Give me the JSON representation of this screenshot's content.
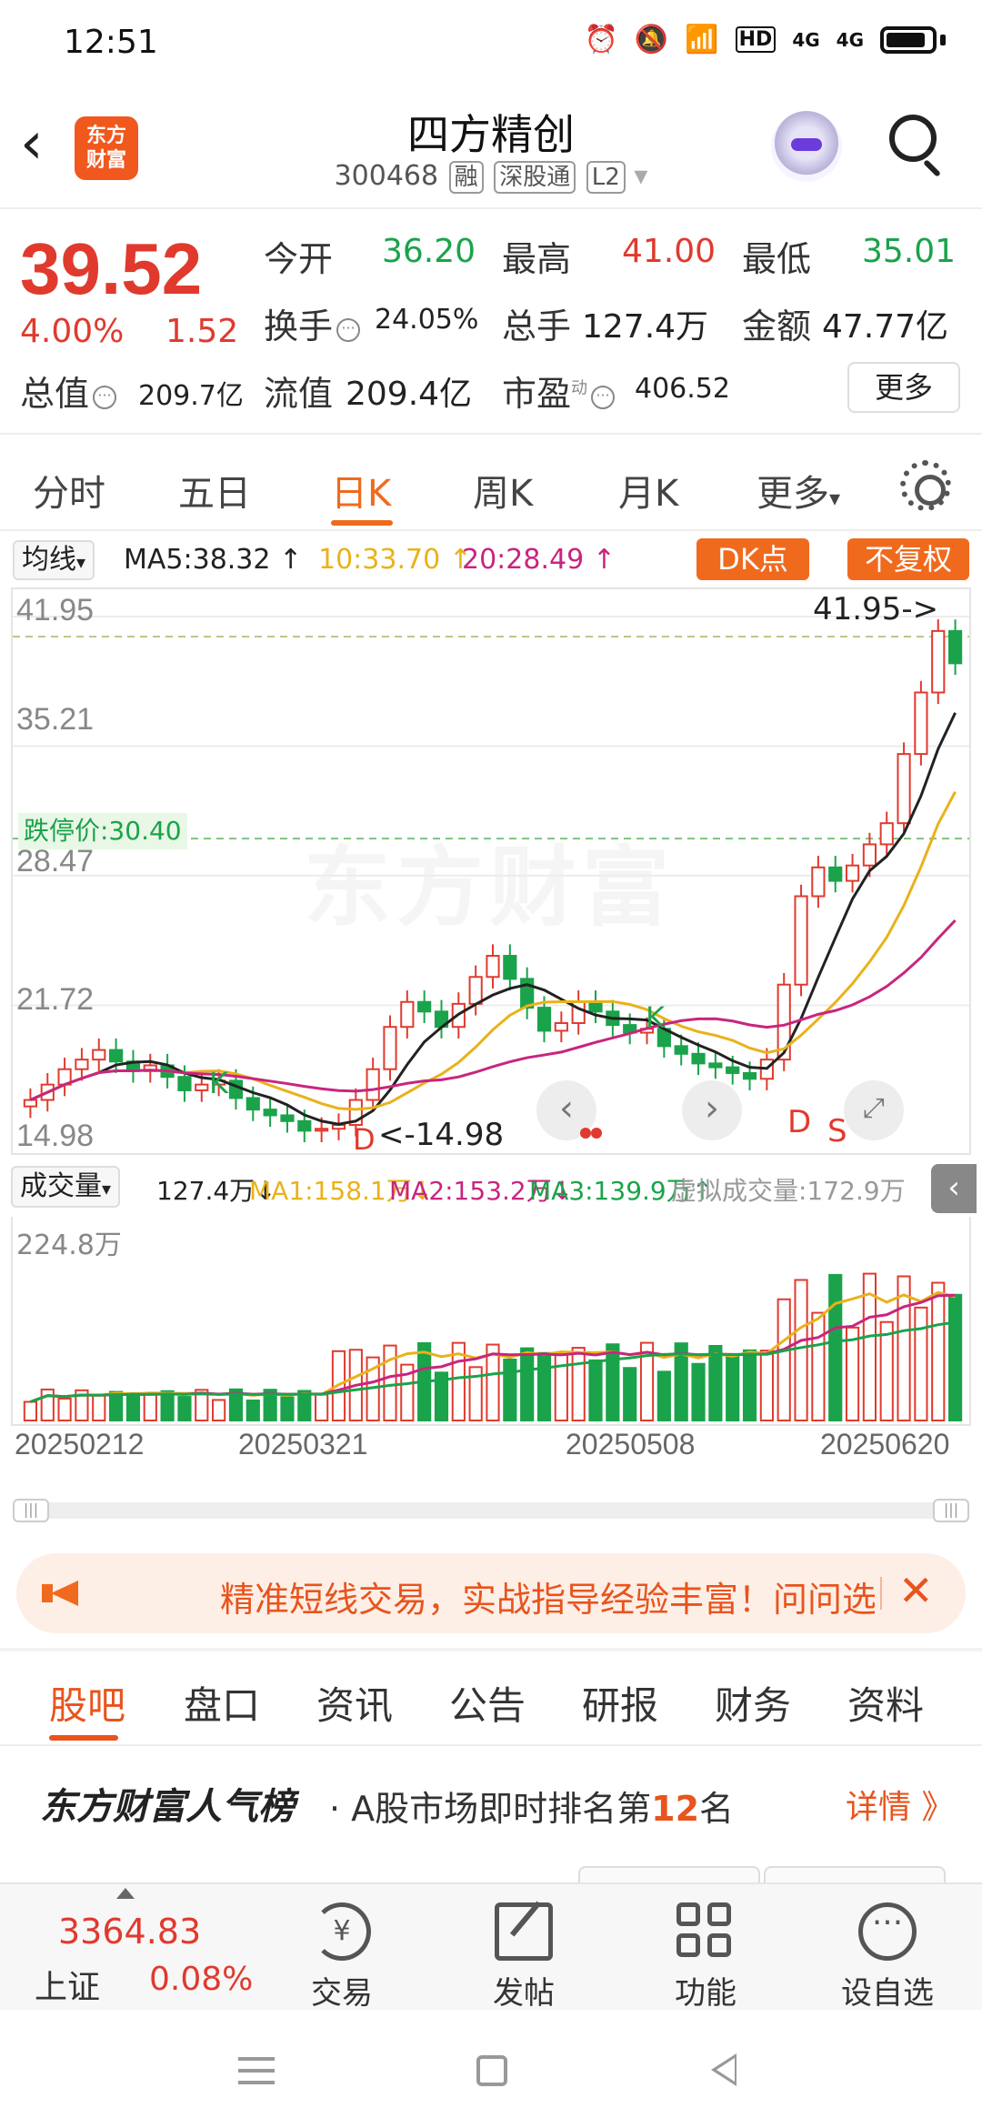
{
  "status": {
    "time": "12:51",
    "icons": [
      "alarm-icon",
      "mute-icon",
      "wifi-icon",
      "hd-icon",
      "4g-signal-icon",
      "4g-signal-icon",
      "battery-icon"
    ],
    "hd": "HD",
    "net1": "4G",
    "net2": "4G"
  },
  "header": {
    "logo_line1": "东方",
    "logo_line2": "财富",
    "name": "四方精创",
    "code": "300468",
    "tags": [
      "融",
      "深股通",
      "L2"
    ]
  },
  "quote": {
    "price": "39.52",
    "change_pct": "4.00%",
    "change_abs": "1.52",
    "open_label": "今开",
    "open": "36.20",
    "high_label": "最高",
    "high": "41.00",
    "low_label": "最低",
    "low": "35.01",
    "turnover_label": "换手",
    "turnover": "24.05%",
    "volume_label": "总手",
    "volume": "127.4万",
    "amount_label": "金额",
    "amount": "47.77亿",
    "mktcap_label": "总值",
    "mktcap": "209.7亿",
    "float_label": "流值",
    "float": "209.4亿",
    "pe_label": "市盈",
    "pe_sup": "动",
    "pe": "406.52",
    "more": "更多"
  },
  "ktabs": [
    "分时",
    "五日",
    "日K",
    "周K",
    "月K",
    "更多"
  ],
  "ma_bar": {
    "select": "均线",
    "ma5": "MA5:38.32",
    "ma10": "10:33.70",
    "ma20": "20:28.49",
    "dk": "DK点",
    "adjust": "不复权",
    "colors": {
      "ma5": "#222222",
      "ma10": "#e9b21a",
      "ma20": "#c8257f"
    }
  },
  "kchart": {
    "watermark": "东方财富",
    "y_labels": [
      "41.95",
      "35.21",
      "28.47",
      "21.72",
      "14.98"
    ],
    "limit_down": "跌停价:30.40",
    "high_marker": "41.95->",
    "low_marker": "<-14.98",
    "signals": [
      "K",
      "K",
      "D",
      "D",
      "S"
    ],
    "nav": {
      "prev": "‹",
      "next": "›"
    }
  },
  "vol_bar": {
    "select": "成交量",
    "vol": "127.4万",
    "ma1": "MA1:158.1万",
    "ma2": "MA2:153.2万",
    "ma3": "MA3:139.9万",
    "virtual": "虚拟成交量:172.9万",
    "handle": "‹"
  },
  "vchart": {
    "max_label": "224.8万"
  },
  "x_labels": [
    "20250212",
    "20250321",
    "20250508",
    "20250620"
  ],
  "promo": {
    "text": "精准短线交易，实战指导经验丰富！问问选股",
    "close": "✕"
  },
  "section_tabs": [
    "股吧",
    "盘口",
    "资讯",
    "公告",
    "研报",
    "财务",
    "资料"
  ],
  "rank": {
    "brand": "东方财富人气榜",
    "text_prefix": "· A股市场即时排名第",
    "rank": "12",
    "text_suffix": "名",
    "detail": "详情 》"
  },
  "bottom_nav": {
    "index_value": "3364.83",
    "index_name": "上证",
    "index_pct": "0.08%",
    "items": [
      "交易",
      "发帖",
      "功能",
      "设自选"
    ]
  },
  "chart_data": {
    "type": "candlestick",
    "x": [
      "20250212",
      "20250321",
      "20250508",
      "20250620"
    ],
    "ylim": [
      14.98,
      41.95
    ],
    "close_approx": [
      16.8,
      17.6,
      18.4,
      18.9,
      19.4,
      18.8,
      18.3,
      18.6,
      18.0,
      17.3,
      17.6,
      17.8,
      16.9,
      16.3,
      16.0,
      15.7,
      15.2,
      15.3,
      15.5,
      16.8,
      18.4,
      20.6,
      21.9,
      21.4,
      20.6,
      21.8,
      23.2,
      24.3,
      23.1,
      21.6,
      20.4,
      20.8,
      21.9,
      21.4,
      20.7,
      20.3,
      20.5,
      19.6,
      19.2,
      18.7,
      18.5,
      18.2,
      17.9,
      18.9,
      22.8,
      27.4,
      28.9,
      28.2,
      29.0,
      30.1,
      31.2,
      34.8,
      38.0,
      41.2,
      39.52
    ]
  }
}
